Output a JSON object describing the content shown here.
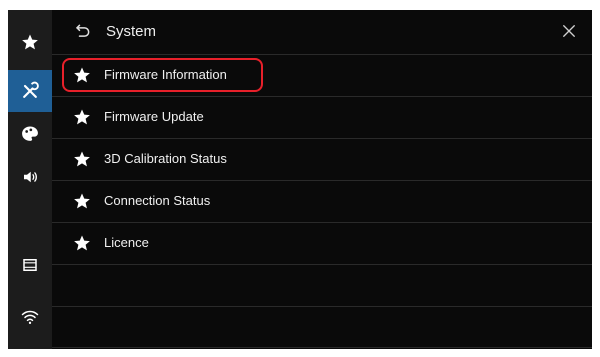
{
  "header": {
    "title": "System"
  },
  "menu": {
    "items": [
      {
        "label": "Firmware Information"
      },
      {
        "label": "Firmware Update"
      },
      {
        "label": "3D Calibration Status"
      },
      {
        "label": "Connection Status"
      },
      {
        "label": "Licence"
      }
    ],
    "highlighted_index": 0
  },
  "sidebar": {
    "items": [
      {
        "icon": "star-icon"
      },
      {
        "icon": "tools-icon",
        "active": true
      },
      {
        "icon": "palette-icon"
      },
      {
        "icon": "speaker-icon"
      },
      {
        "icon": "film-icon"
      },
      {
        "icon": "wifi-icon"
      }
    ]
  },
  "colors": {
    "background": "#0a0a0a",
    "sidebar": "#1c1c1c",
    "active": "#1f5f96",
    "highlight": "#e8202a"
  }
}
